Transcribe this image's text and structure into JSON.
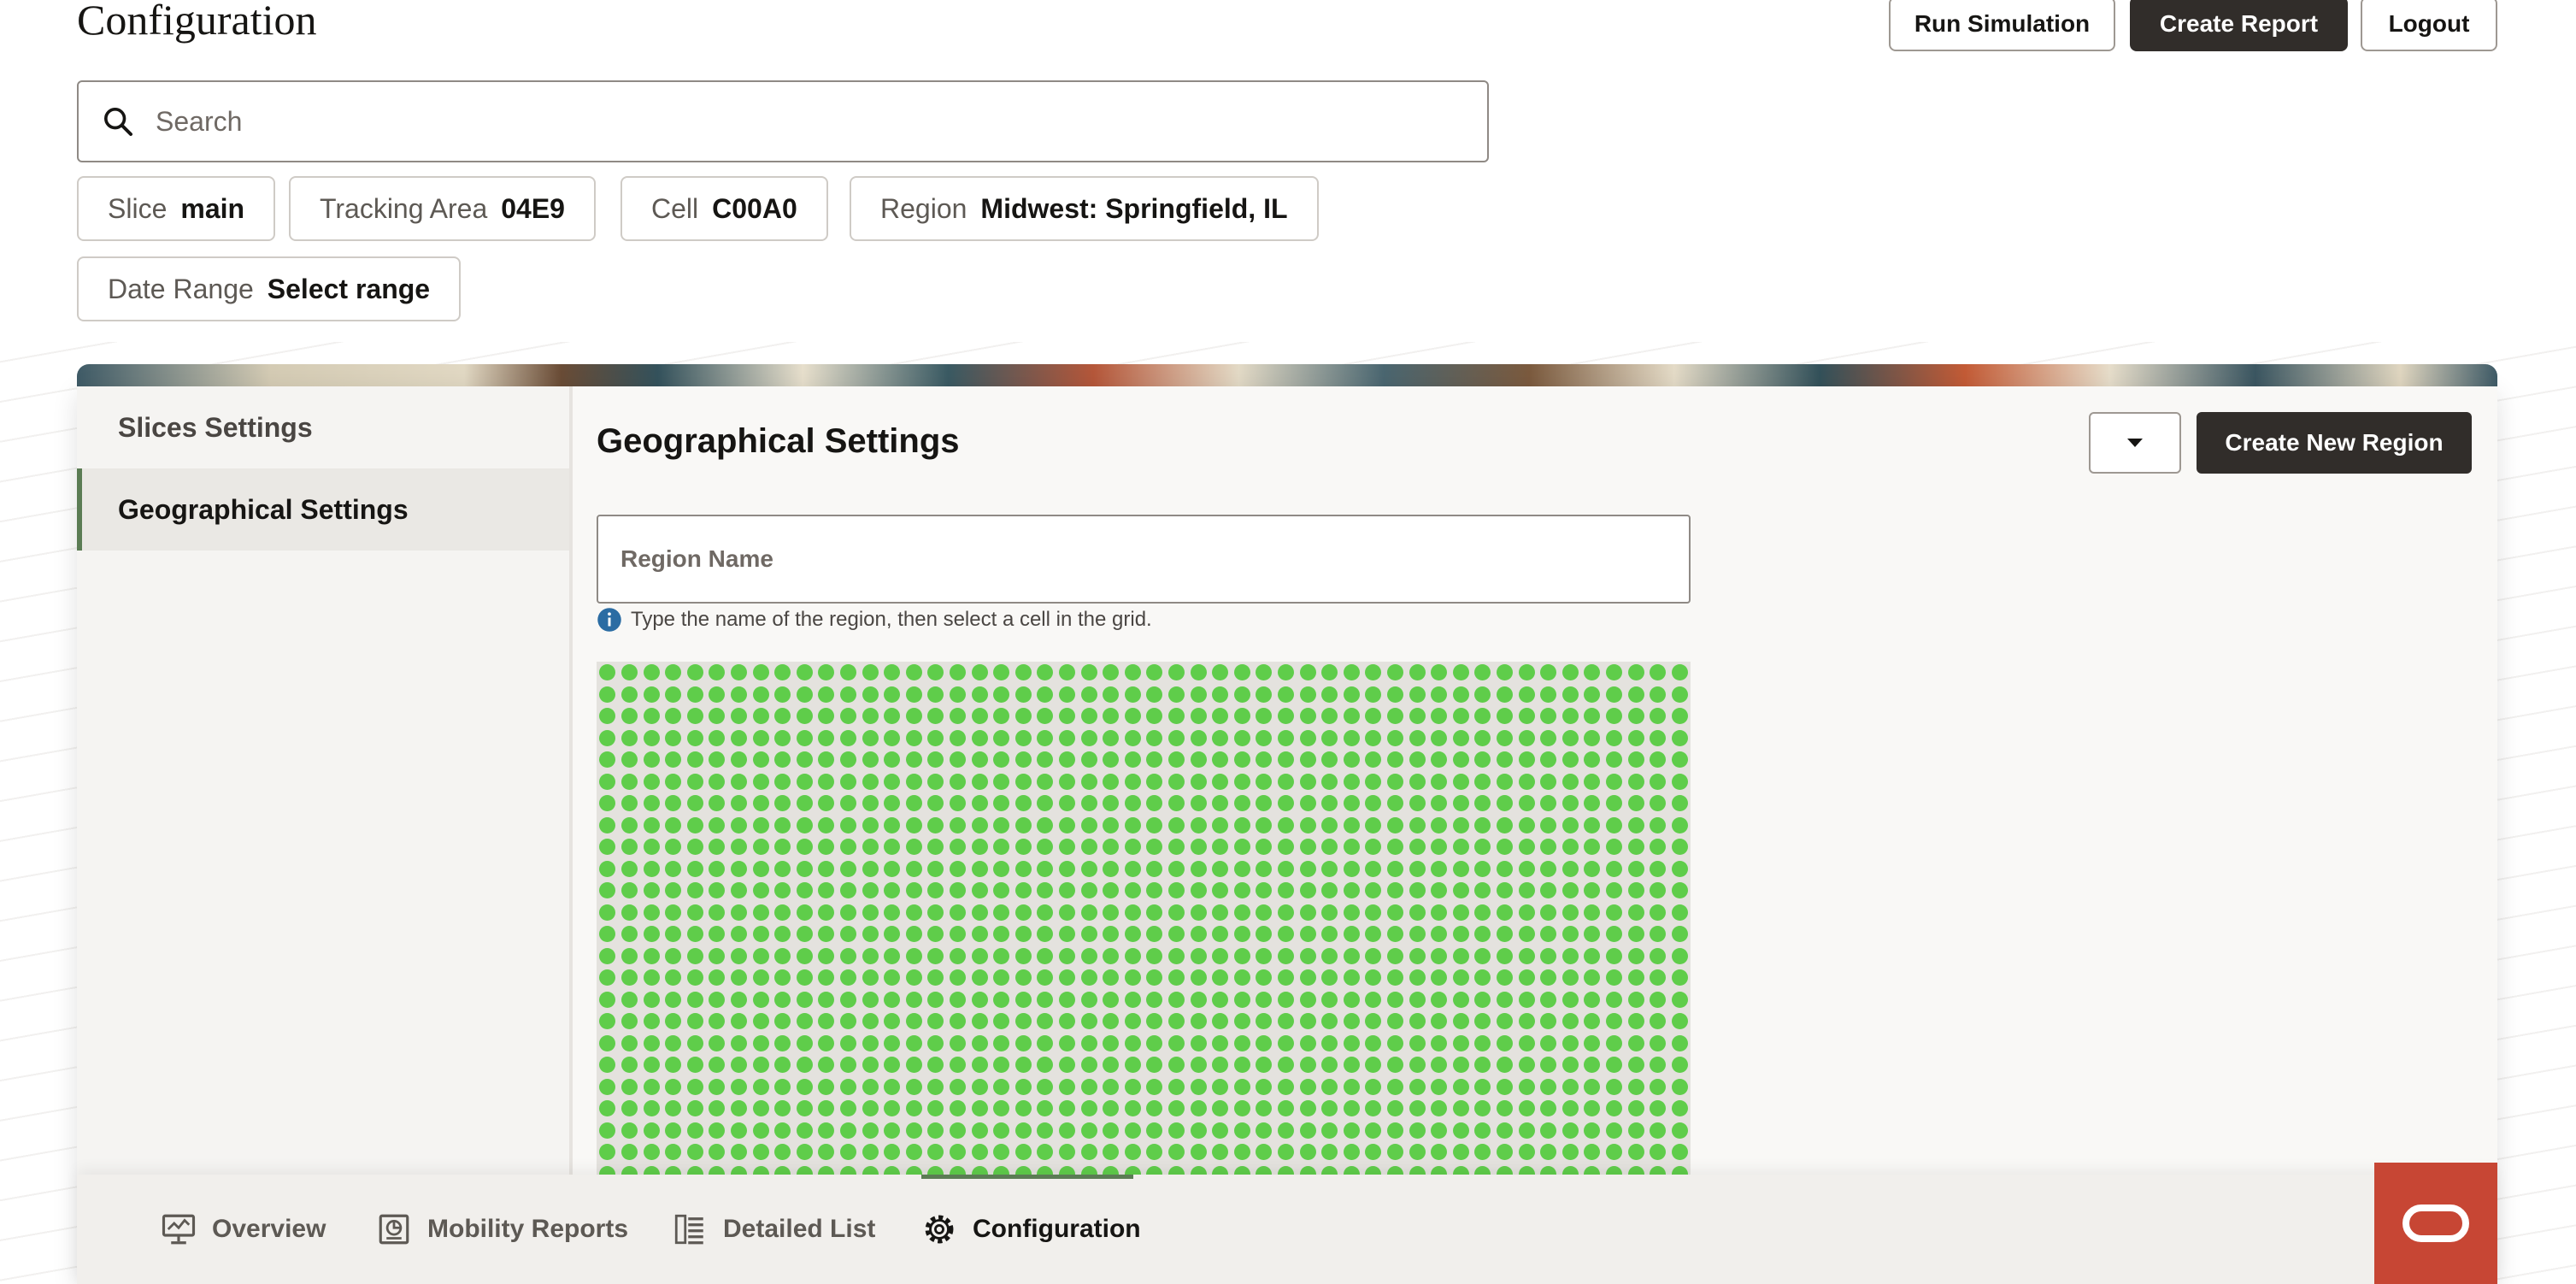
{
  "page": {
    "title": "Configuration"
  },
  "header": {
    "run_simulation": "Run Simulation",
    "create_report": "Create Report",
    "logout": "Logout"
  },
  "search": {
    "placeholder": "Search"
  },
  "filters": {
    "slice": {
      "label": "Slice",
      "value": "main"
    },
    "tracking_area": {
      "label": "Tracking Area",
      "value": "04E9"
    },
    "cell": {
      "label": "Cell",
      "value": "C00A0"
    },
    "region": {
      "label": "Region",
      "value": "Midwest: Springfield, IL"
    },
    "date_range": {
      "label": "Date Range",
      "value": "Select range"
    }
  },
  "sidebar": {
    "items": [
      {
        "label": "Slices Settings",
        "active": false
      },
      {
        "label": "Geographical Settings",
        "active": true
      }
    ]
  },
  "main": {
    "title": "Geographical Settings",
    "create_button": "Create New Region",
    "region_input": {
      "placeholder": "Region Name",
      "value": ""
    },
    "helper_text": "Type the name of the region, then select a cell in the grid.",
    "grid": {
      "columns": 50,
      "visible_rows": 24,
      "cell_color": "#5fcd4a",
      "state": "all cells available"
    }
  },
  "bottom_nav": {
    "items": [
      {
        "label": "Overview",
        "icon": "monitor-chart-icon"
      },
      {
        "label": "Mobility Reports",
        "icon": "report-icon"
      },
      {
        "label": "Detailed List",
        "icon": "list-icon"
      },
      {
        "label": "Configuration",
        "icon": "gear-icon"
      }
    ],
    "active": "Configuration"
  },
  "colors": {
    "primary_dark": "#312d2a",
    "accent_green": "#5b7c54",
    "cell_green": "#5fcd4a",
    "oracle_red": "#c74634"
  }
}
